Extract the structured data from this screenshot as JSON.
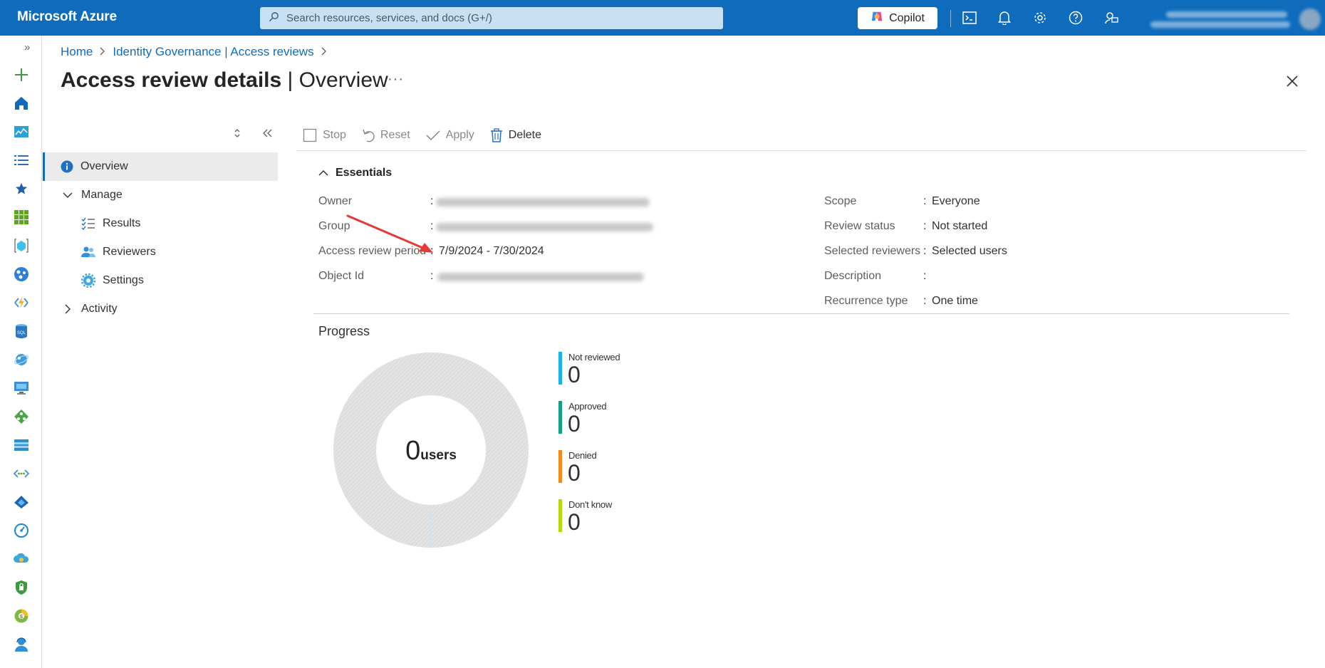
{
  "topbar": {
    "brand": "Microsoft Azure",
    "search_placeholder": "Search resources, services, and docs (G+/)",
    "copilot_label": "Copilot",
    "icons": [
      "cloud-shell-icon",
      "bell-icon",
      "gear-icon",
      "help-icon",
      "feedback-icon"
    ]
  },
  "breadcrumb": {
    "items": [
      "Home",
      "Identity Governance | Access reviews"
    ]
  },
  "page": {
    "title_main": "Access review details",
    "title_sep": " | ",
    "title_sub": "Overview",
    "more": "···"
  },
  "subnav": {
    "items": [
      {
        "label": "Overview",
        "icon": "info-icon"
      },
      {
        "label": "Manage",
        "icon": "chevron-down-icon"
      },
      {
        "label": "Results",
        "icon": "checklist-icon"
      },
      {
        "label": "Reviewers",
        "icon": "people-icon"
      },
      {
        "label": "Settings",
        "icon": "gear-icon"
      },
      {
        "label": "Activity",
        "icon": "chevron-right-icon"
      }
    ]
  },
  "toolbar": {
    "stop": "Stop",
    "reset": "Reset",
    "apply": "Apply",
    "delete": "Delete"
  },
  "essentials": {
    "heading": "Essentials",
    "left": [
      {
        "label": "Owner",
        "value": ""
      },
      {
        "label": "Group",
        "value": ""
      },
      {
        "label": "Access review period",
        "value": "7/9/2024 - 7/30/2024"
      },
      {
        "label": "Object Id",
        "value": ""
      }
    ],
    "right": [
      {
        "label": "Scope",
        "value": "Everyone"
      },
      {
        "label": "Review status",
        "value": "Not started"
      },
      {
        "label": "Selected reviewers",
        "value": "Selected users"
      },
      {
        "label": "Description",
        "value": ""
      },
      {
        "label": "Recurrence type",
        "value": "One time"
      }
    ]
  },
  "progress": {
    "title": "Progress",
    "total": "0",
    "total_unit": "users",
    "legend": [
      {
        "label": "Not reviewed",
        "value": "0",
        "color": "#1ab0ea"
      },
      {
        "label": "Approved",
        "value": "0",
        "color": "#14a085"
      },
      {
        "label": "Denied",
        "value": "0",
        "color": "#f7891a"
      },
      {
        "label": "Don't know",
        "value": "0",
        "color": "#bad80a"
      }
    ]
  },
  "colors": {
    "brand_blue": "#0f6cbd",
    "donut_empty": "#e0e0e0",
    "annotation_arrow": "#e53935"
  }
}
